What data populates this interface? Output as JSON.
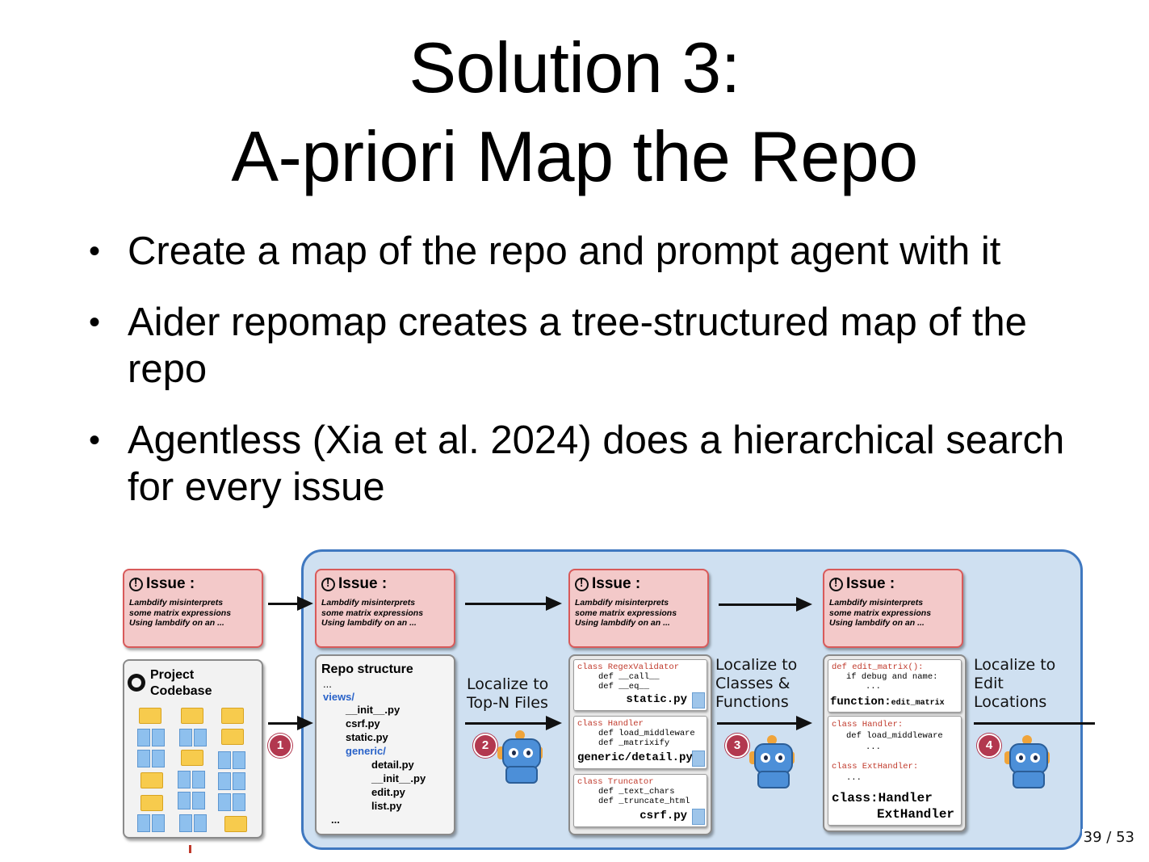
{
  "slide": {
    "title_line1": "Solution 3:",
    "title_line2": "A-priori Map the Repo",
    "bullets": [
      "Create a map of the repo and prompt agent with it",
      "Aider repomap creates a tree-structured map of the repo",
      "Agentless (Xia et al. 2024) does a hierarchical search for every issue"
    ],
    "page_number": "39 / 53"
  },
  "figure": {
    "issue": {
      "heading": "Issue :",
      "body_line1": "Lambdify misinterprets",
      "body_line2": "some matrix expressions",
      "body_line3": "Using lambdify on an ..."
    },
    "project": {
      "label_line1": "Project",
      "label_line2": "Codebase"
    },
    "repo_structure": {
      "heading": "Repo structure",
      "lines": [
        "...",
        "views/",
        "__init__.py",
        "csrf.py",
        "static.py",
        "generic/",
        "detail.py",
        "__init__.py",
        "edit.py",
        "list.py",
        "..."
      ]
    },
    "stage_labels": {
      "files": "Localize to\nTop-N Files",
      "classes": "Localize to\nClasses &\nFunctions",
      "edits": "Localize to\nEdit\nLocations"
    },
    "steps": [
      "1",
      "2",
      "3",
      "4"
    ],
    "files_stage": {
      "box1": {
        "l1": "class RegexValidator",
        "l2": "def __call__",
        "l3": "def __eq__",
        "file": "static.py"
      },
      "box2": {
        "l1": "class Handler",
        "l2": "def load_middleware",
        "l3": "def _matrixify",
        "file": "generic/detail.py"
      },
      "box3": {
        "l1": "class Truncator",
        "l2": "def _text_chars",
        "l3": "def _truncate_html",
        "file": "csrf.py"
      }
    },
    "classes_stage": {
      "box1": {
        "l1": "def edit_matrix():",
        "l2": "if debug and name:",
        "l3": "...",
        "fn_prefix": "function:",
        "fn_name": "edit_matrix"
      },
      "box2": {
        "l1": "class Handler:",
        "l2": "def load_middleware",
        "l3": "...",
        "l4": "class ExtHandler:",
        "l5": "...",
        "cls_prefix": "class:",
        "cls1": "Handler",
        "cls2": "ExtHandler"
      }
    }
  }
}
